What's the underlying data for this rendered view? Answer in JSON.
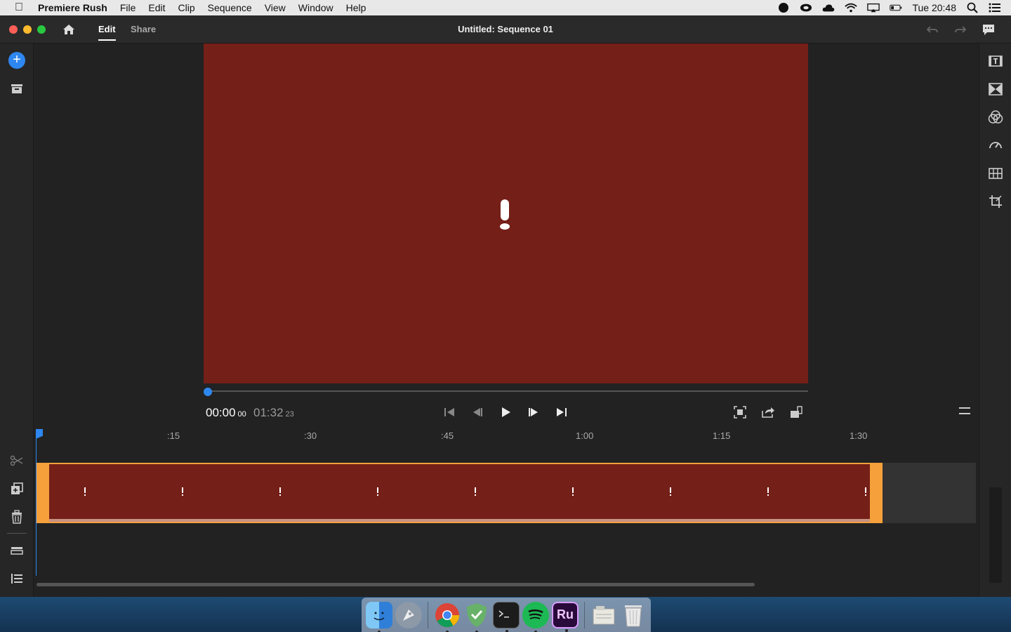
{
  "menubar": {
    "app_name": "Premiere Rush",
    "items": [
      "File",
      "Edit",
      "Clip",
      "Sequence",
      "View",
      "Window",
      "Help"
    ],
    "clock": "Tue 20:48",
    "status_icons": [
      "1password-icon",
      "creative-cloud-icon",
      "cloud-icon",
      "wifi-icon",
      "airplay-icon",
      "battery-icon",
      "spotlight-icon",
      "notification-center-icon"
    ]
  },
  "titlebar": {
    "tabs": [
      {
        "label": "Edit",
        "active": true
      },
      {
        "label": "Share",
        "active": false
      }
    ],
    "sequence_title": "Untitled: Sequence 01"
  },
  "monitor": {
    "background_color": "#741f18",
    "alert_icon": "exclamation-icon"
  },
  "transport": {
    "current_time": "00:00",
    "current_frames": "00",
    "duration": "01:32",
    "duration_frames": "23"
  },
  "timeline": {
    "ruler_labels": [
      ":15",
      ":30",
      ":45",
      "1:00",
      "1:15",
      "1:30"
    ],
    "clip_color": "#741f18",
    "clip_border_color": "#f5a03a",
    "accent_color": "#2e87f0"
  },
  "dock": {
    "apps": [
      "Finder",
      "Launchpad",
      "Chrome",
      "AdGuard",
      "Terminal",
      "Spotify",
      "Premiere Rush",
      "Documents",
      "Trash"
    ],
    "rush_label": "Ru"
  }
}
